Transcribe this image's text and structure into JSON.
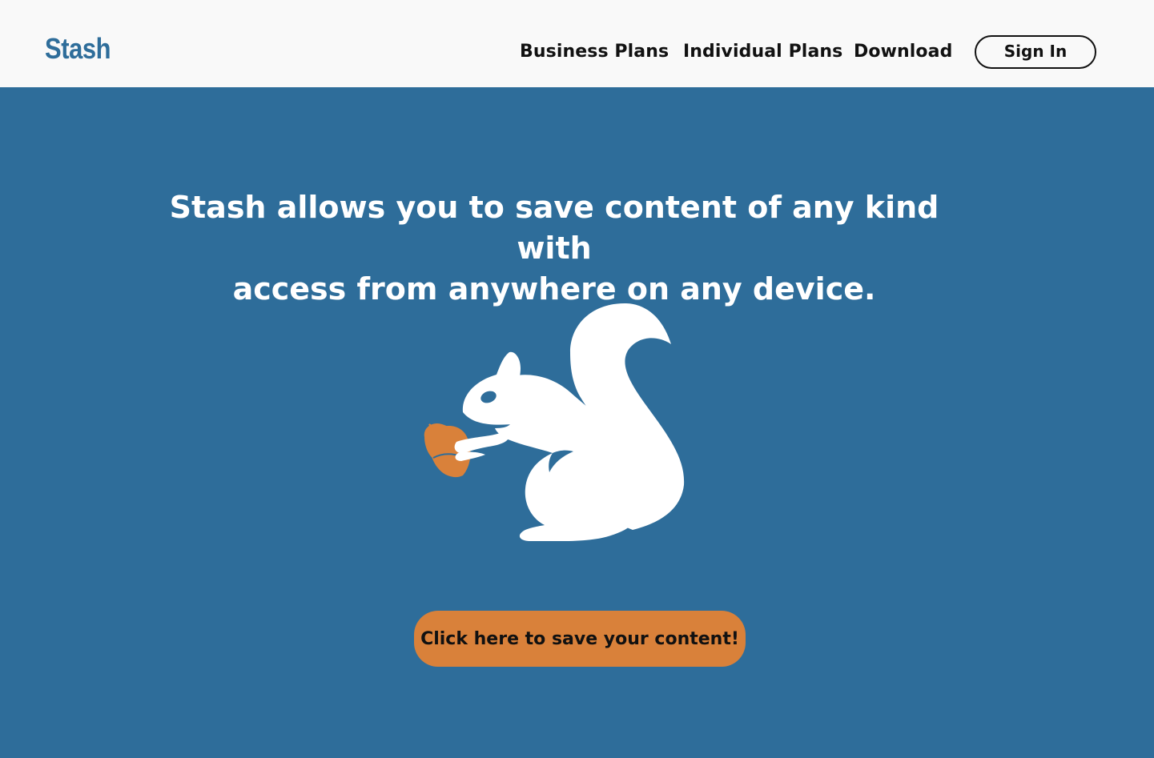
{
  "header": {
    "logo": "Stash",
    "nav": {
      "business_plans": "Business Plans",
      "individual_plans": "Individual Plans",
      "download": "Download"
    },
    "sign_in": "Sign In"
  },
  "hero": {
    "headline_line1": "Stash allows you to save content of any kind with",
    "headline_line2": "access from anywhere on any device.",
    "mascot_icon": "squirrel-with-acorn-icon",
    "cta_label": "Click here to save your content!"
  },
  "colors": {
    "brand_blue": "#2e6d9a",
    "header_bg": "#f9f9f9",
    "accent_orange": "#d9813a",
    "text_dark": "#111111",
    "text_light": "#ffffff"
  }
}
